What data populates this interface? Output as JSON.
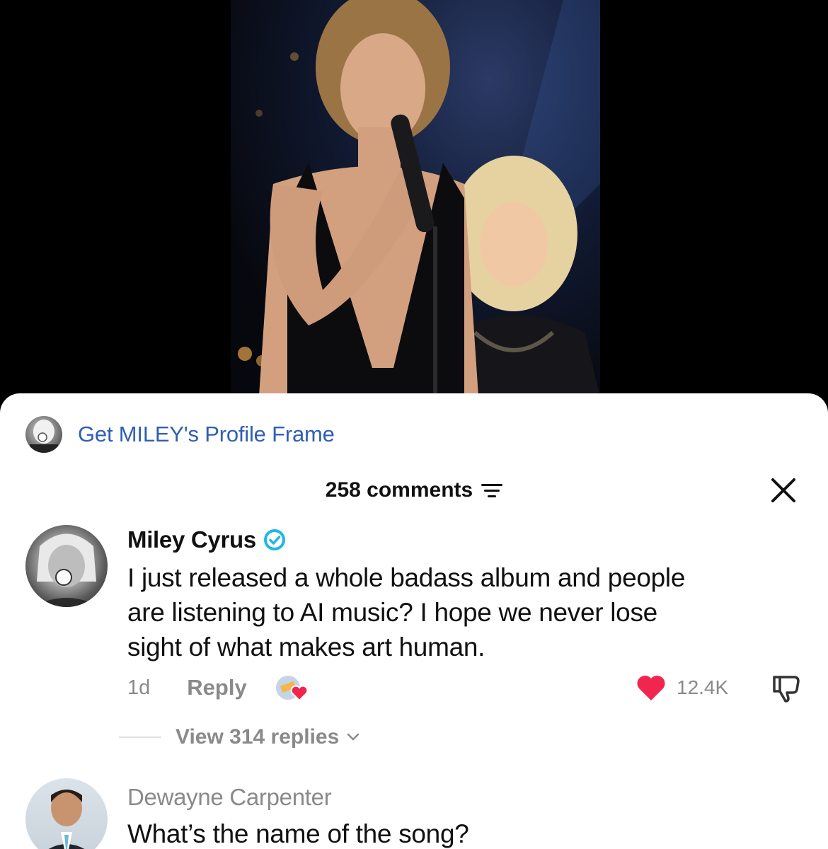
{
  "video": {
    "description_icon": "video-frame"
  },
  "profile_frame": {
    "label": "Get MILEY's Profile Frame"
  },
  "comments_header": {
    "count_label": "258 comments",
    "filter_icon": "filter-icon",
    "close_icon": "close-icon"
  },
  "comments": [
    {
      "author": "Miley Cyrus",
      "verified": true,
      "text_lines": [
        "I just released a whole badass album and people",
        "are listening to AI music? I hope we never lose",
        "sight of what makes art human."
      ],
      "time": "1d",
      "reply_label": "Reply",
      "likes": "12.4K",
      "view_replies": "View 314 replies"
    },
    {
      "author": "Dewayne Carpenter",
      "verified": false,
      "text_lines": [
        "What’s the name of the song?"
      ]
    }
  ],
  "colors": {
    "link_blue": "#2f5fb3",
    "verified_blue": "#20b6e8",
    "like_red": "#f0264f",
    "meta_gray": "#8a8a8a"
  }
}
